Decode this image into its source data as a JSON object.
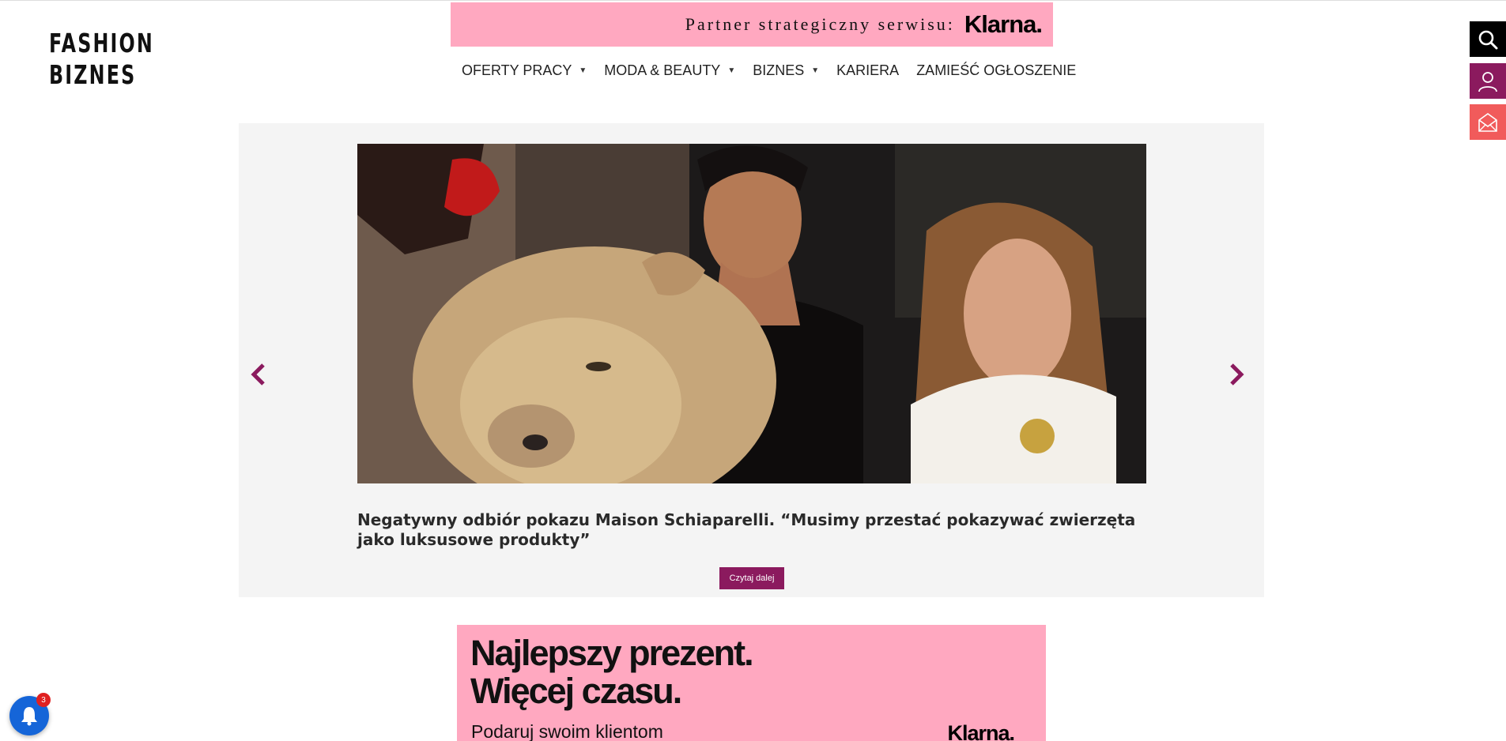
{
  "header": {
    "logo_line1": "FASHION",
    "logo_line2": "BIZNES",
    "partner_text": "Partner strategiczny serwisu:",
    "partner_brand": "Klarna."
  },
  "nav": {
    "items": [
      {
        "label": "OFERTY PRACY",
        "has_dropdown": true
      },
      {
        "label": "MODA & BEAUTY",
        "has_dropdown": true
      },
      {
        "label": "BIZNES",
        "has_dropdown": true
      },
      {
        "label": "KARIERA",
        "has_dropdown": false
      },
      {
        "label": "ZAMIEŚĆ OGŁOSZENIE",
        "has_dropdown": false
      }
    ],
    "caret": "▼"
  },
  "side_buttons": {
    "search_icon": "search-icon",
    "user_icon": "user-icon",
    "mail_icon": "mail-icon"
  },
  "slider": {
    "title": "Negatywny odbiór pokazu Maison Schiaparelli. “Musimy przestać pokazywać zwierzęta jako luksusowe produkty”",
    "read_more": "Czytaj dalej",
    "prev_icon": "chevron-left-icon",
    "next_icon": "chevron-right-icon"
  },
  "ad": {
    "headline_line1": "Najlepszy prezent.",
    "headline_line2": "Więcej czasu.",
    "sub": "Podaruj swoim klientom",
    "brand": "Klarna."
  },
  "notifications": {
    "count": "3"
  },
  "colors": {
    "brand_accent": "#8b1a5e",
    "klarna_pink": "#ffa8c0",
    "mail_red": "#f15b5b",
    "notif_blue": "#1565d8"
  }
}
